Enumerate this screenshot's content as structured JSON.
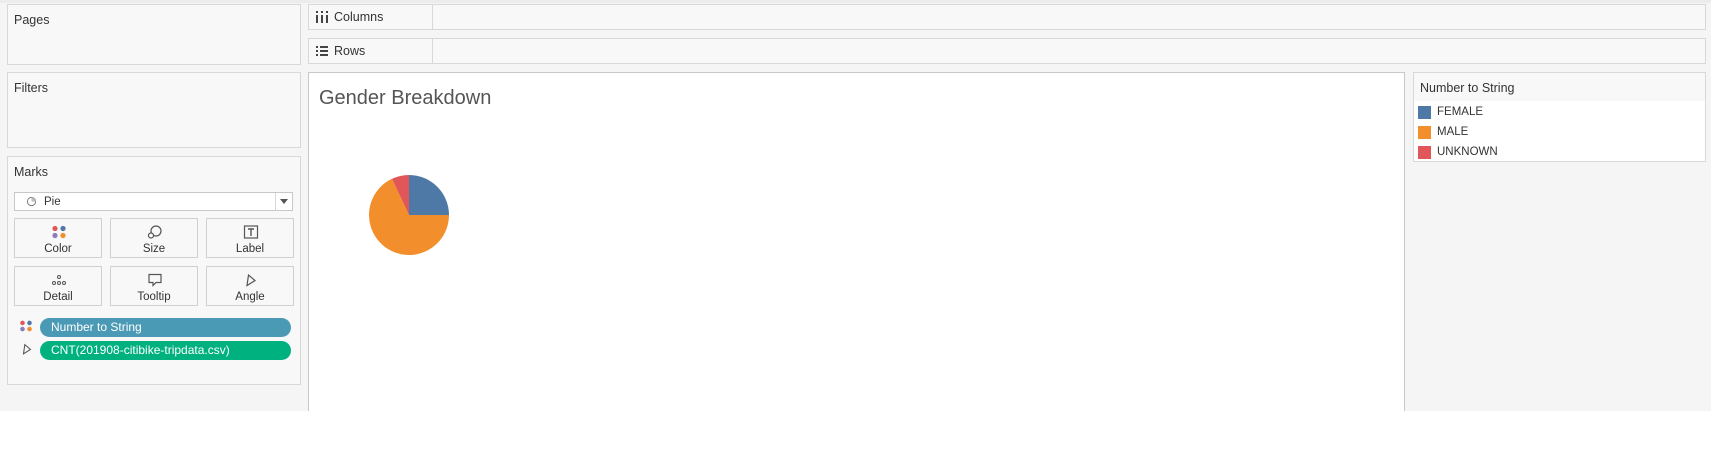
{
  "pages": {
    "title": "Pages"
  },
  "filters": {
    "title": "Filters"
  },
  "shelves": {
    "columns": {
      "label": "Columns",
      "icon": "columns-icon"
    },
    "rows": {
      "label": "Rows",
      "icon": "rows-icon"
    }
  },
  "marks": {
    "title": "Marks",
    "mark_type": {
      "value": "Pie",
      "icon": "pie-icon"
    },
    "buttons": [
      {
        "label": "Color",
        "icon": "color-icon"
      },
      {
        "label": "Size",
        "icon": "size-icon"
      },
      {
        "label": "Label",
        "icon": "label-icon"
      },
      {
        "label": "Detail",
        "icon": "detail-icon"
      },
      {
        "label": "Tooltip",
        "icon": "tooltip-icon"
      },
      {
        "label": "Angle",
        "icon": "angle-icon"
      }
    ],
    "pills": [
      {
        "text": "Number to String",
        "encoding_icon": "color-icon",
        "color": "#4a9ab5"
      },
      {
        "text": "CNT(201908-citibike-tripdata.csv)",
        "encoding_icon": "angle-icon",
        "color": "#00b180"
      }
    ]
  },
  "view": {
    "title": "Gender Breakdown"
  },
  "legend": {
    "title": "Number to String",
    "items": [
      {
        "label": "FEMALE",
        "color": "#4e79a7"
      },
      {
        "label": "MALE",
        "color": "#f28e2b"
      },
      {
        "label": "UNKNOWN",
        "color": "#e15759"
      }
    ]
  },
  "chart_data": {
    "type": "pie",
    "title": "Gender Breakdown",
    "legend_position": "right",
    "slices": [
      {
        "label": "FEMALE",
        "value": 25,
        "color": "#4e79a7"
      },
      {
        "label": "MALE",
        "value": 68,
        "color": "#f28e2b"
      },
      {
        "label": "UNKNOWN",
        "value": 7,
        "color": "#e15759"
      }
    ]
  }
}
